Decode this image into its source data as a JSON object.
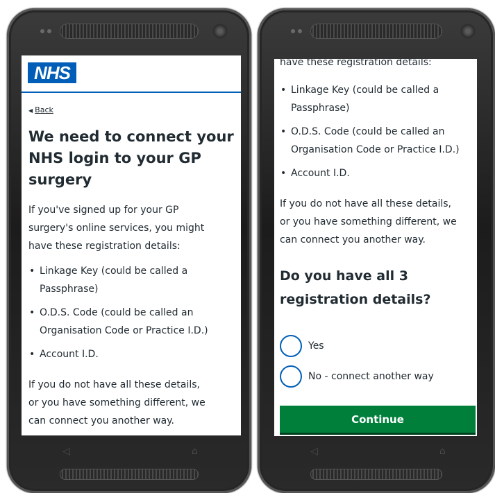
{
  "logo": "NHS",
  "back_link": "Back",
  "page_title": "We need to connect your NHS login to your GP surgery",
  "intro_lines": [
    "If you've signed up for your GP",
    "surgery's online services, you might",
    "have these registration details:"
  ],
  "details": [
    [
      "Linkage Key (could be called a",
      "Passphrase)"
    ],
    [
      "O.D.S. Code (could be called an",
      "Organisation Code or Practice I.D.)"
    ],
    [
      "Account I.D."
    ]
  ],
  "note_lines": [
    "If you do not have all these details,",
    "or you have something different, we",
    "can connect you another way."
  ],
  "question": "Do you have all 3 registration details?",
  "options": [
    "Yes",
    "No - connect another way"
  ],
  "continue_label": "Continue",
  "colors": {
    "nhs_blue": "#005eb8",
    "button_green": "#007f3b",
    "text": "#212b32"
  },
  "icons": [
    "back-chevron-icon",
    "nav-back-icon",
    "nav-home-icon"
  ]
}
